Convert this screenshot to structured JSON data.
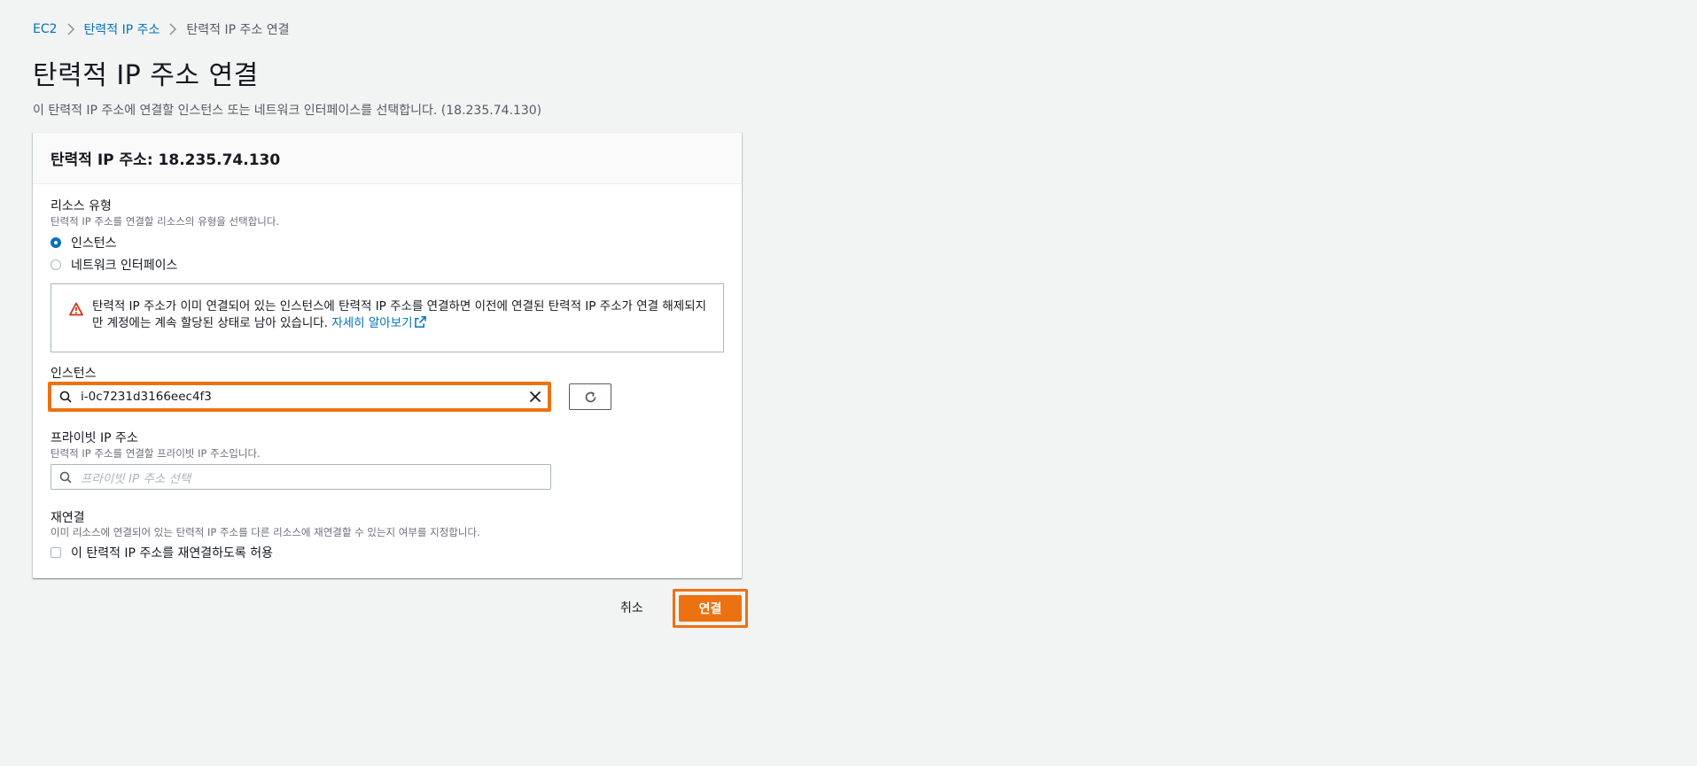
{
  "breadcrumb": {
    "items": [
      "EC2",
      "탄력적 IP 주소",
      "탄력적 IP 주소 연결"
    ]
  },
  "page": {
    "title": "탄력적 IP 주소 연결",
    "description": "이 탄력적 IP 주소에 연결할 인스턴스 또는 네트워크 인터페이스를 선택합니다. (18.235.74.130)"
  },
  "panel": {
    "title": "탄력적 IP 주소: 18.235.74.130",
    "resource_type": {
      "label": "리소스 유형",
      "description": "탄력적 IP 주소를 연결할 리소스의 유형을 선택합니다.",
      "options": [
        "인스턴스",
        "네트워크 인터페이스"
      ],
      "selected": "인스턴스"
    },
    "alert": {
      "text": "탄력적 IP 주소가 이미 연결되어 있는 인스턴스에 탄력적 IP 주소를 연결하면 이전에 연결된 탄력적 IP 주소가 연결 해제되지만 계정에는 계속 할당된 상태로 남아 있습니다. ",
      "link": "자세히 알아보기"
    },
    "instance": {
      "label": "인스턴스",
      "value": "i-0c7231d3166eec4f3"
    },
    "private_ip": {
      "label": "프라이빗 IP 주소",
      "description": "탄력적 IP 주소를 연결할 프라이빗 IP 주소입니다.",
      "placeholder": "프라이빗 IP 주소 선택"
    },
    "reassociate": {
      "label": "재연결",
      "description": "이미 리소스에 연결되어 있는 탄력적 IP 주소를 다른 리소스에 재연결할 수 있는지 여부를 지정합니다.",
      "checkbox_label": "이 탄력적 IP 주소를 재연결하도록 허용",
      "checked": false
    }
  },
  "footer": {
    "cancel_label": "취소",
    "associate_label": "연결"
  },
  "colors": {
    "link": "#0073bb",
    "primary": "#ec7211",
    "background": "#f2f3f3",
    "warning": "#d13212"
  }
}
